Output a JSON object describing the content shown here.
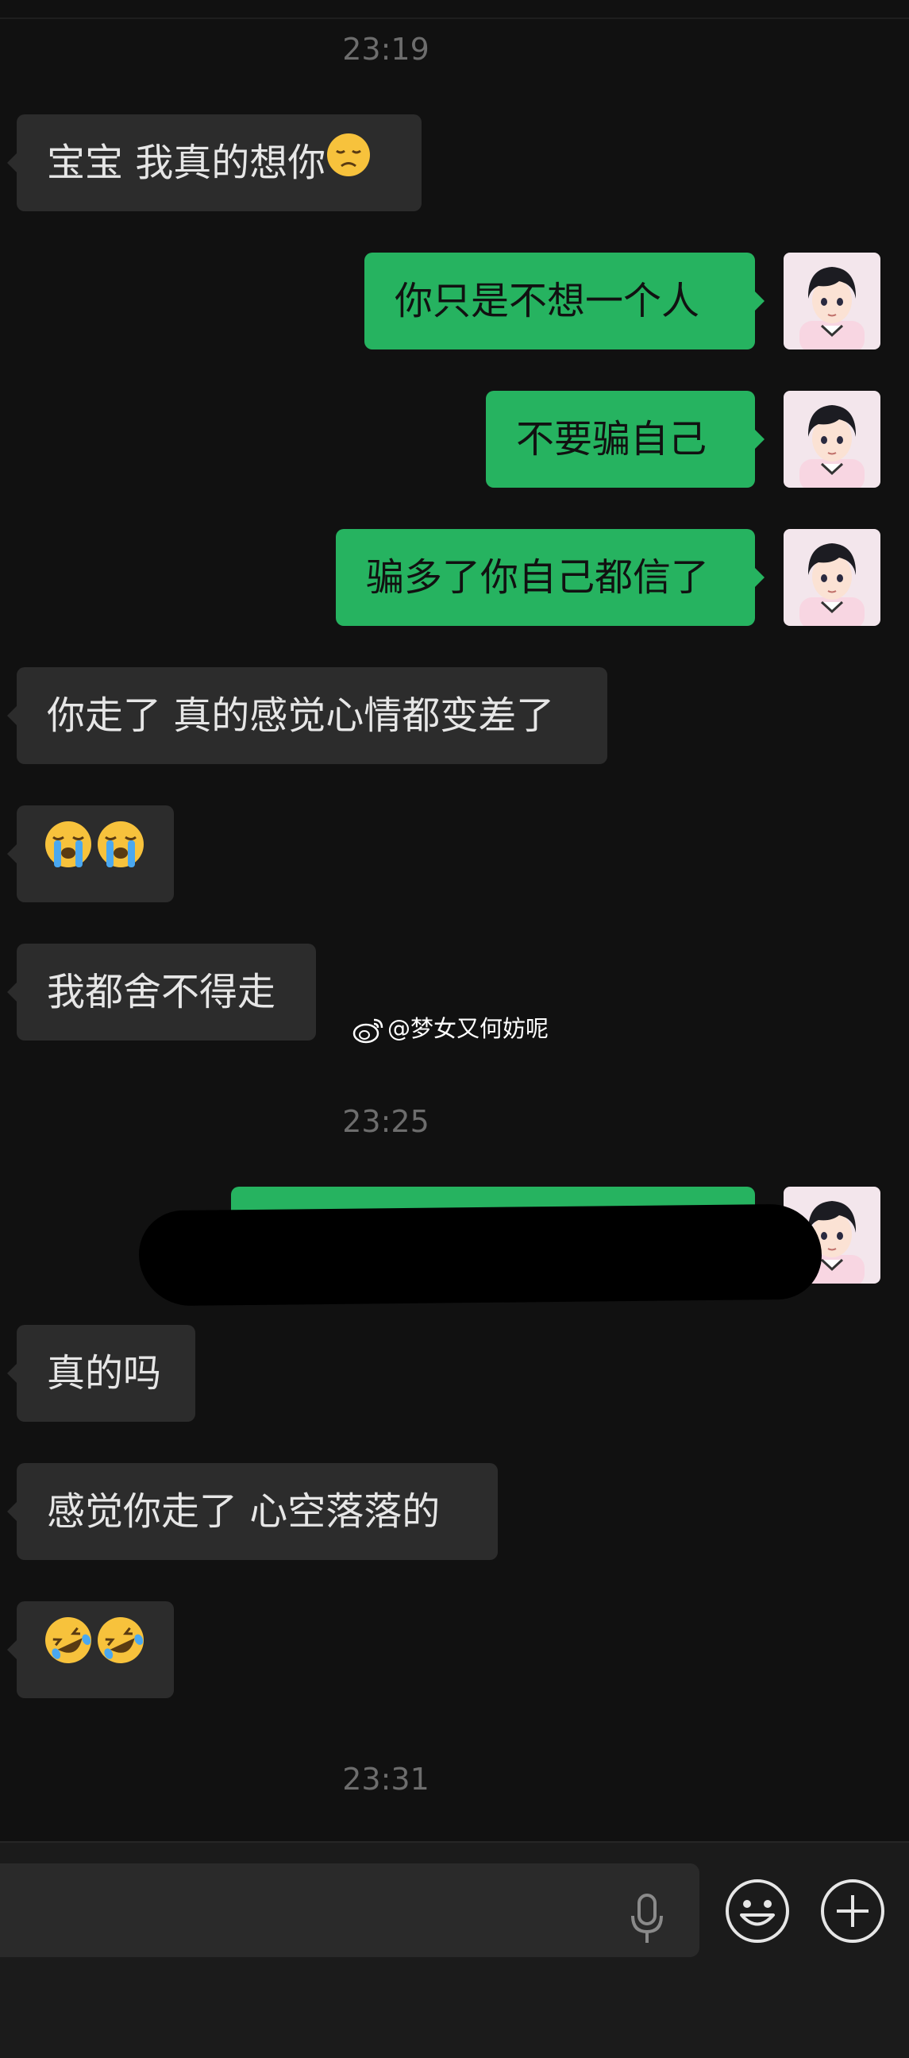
{
  "chat": {
    "time_1": "23:19",
    "time_2": "23:25",
    "time_3": "23:31",
    "messages": [
      {
        "side": "in",
        "text": "宝宝 我真的想你",
        "emoji": "disappointed-face"
      },
      {
        "side": "out",
        "text": "你只是不想一个人"
      },
      {
        "side": "out",
        "text": "不要骗自己"
      },
      {
        "side": "out",
        "text": "骗多了你自己都信了"
      },
      {
        "side": "in",
        "text": "你走了 真的感觉心情都变差了"
      },
      {
        "side": "in",
        "text": "",
        "emoji": "loudly-crying-face x2"
      },
      {
        "side": "in",
        "text": "我都舍不得走"
      },
      {
        "side": "out",
        "text": "",
        "redacted": true
      },
      {
        "side": "in",
        "text": "真的吗"
      },
      {
        "side": "in",
        "text": "感觉你走了 心空落落的"
      },
      {
        "side": "in",
        "text": "",
        "emoji": "rolling-on-floor-laughing x2"
      }
    ]
  },
  "watermark": {
    "text": "@梦女又何妨呢",
    "icon": "weibo-icon"
  },
  "colors": {
    "background": "#111111",
    "incoming_bubble": "#2c2c2c",
    "outgoing_bubble": "#26b360",
    "timestamp": "#6d6d6d"
  },
  "input_bar": {
    "icons": [
      "microphone-icon",
      "emoji-icon",
      "plus-icon"
    ]
  }
}
